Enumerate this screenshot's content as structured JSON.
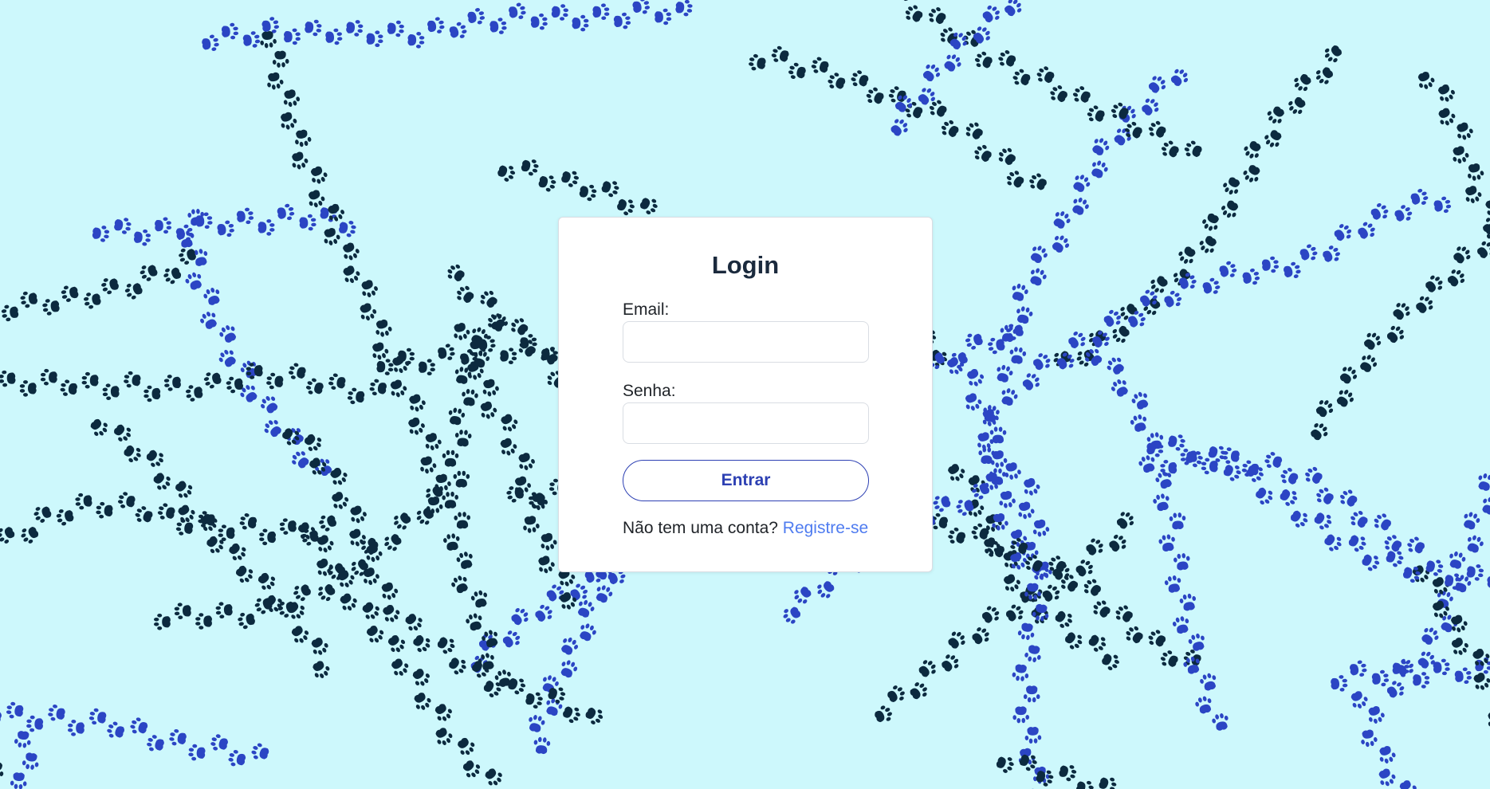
{
  "background": {
    "color": "#cdf8fc",
    "pattern_icon": "paw-print-icon",
    "paw_colors": [
      "#0c2a3f",
      "#2b45c4"
    ]
  },
  "login": {
    "title": "Login",
    "email_label": "Email:",
    "email_value": "",
    "password_label": "Senha:",
    "password_value": "",
    "submit_label": "Entrar",
    "register_prompt": "Não tem uma conta?",
    "register_link": "Registre-se"
  },
  "colors": {
    "title": "#1b2a3d",
    "button_accent": "#2d40b3",
    "link": "#4f7cf0"
  }
}
